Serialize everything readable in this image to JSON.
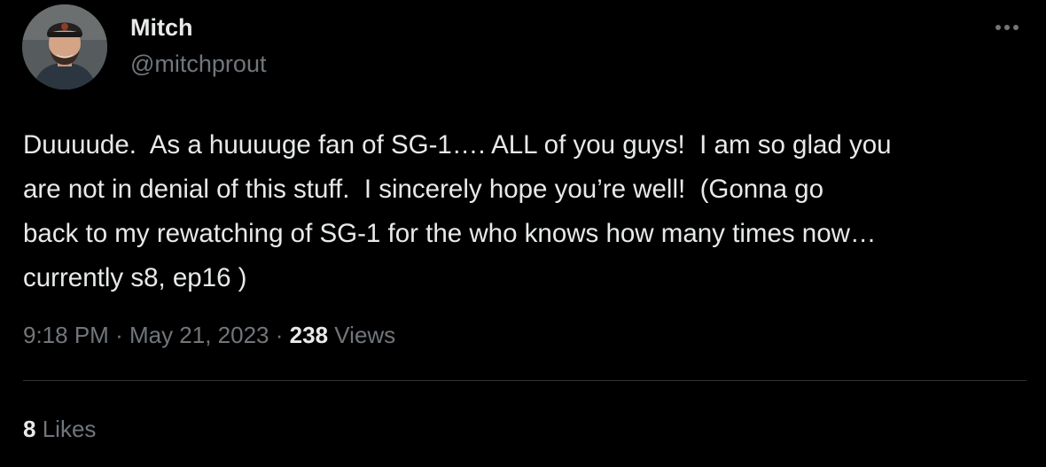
{
  "author": {
    "name": "Mitch",
    "handle": "@mitchprout"
  },
  "more_icon": "more-horizontal-icon",
  "tweet": {
    "text_lines": [
      "Duuuude.  As a huuuuge fan of SG-1…. ALL of you guys!  I am so glad you",
      "are not in denial of this stuff.  I sincerely hope you’re well!  (Gonna go",
      "back to my rewatching of SG-1 for the who knows how many times now…",
      "currently s8, ep16 )"
    ]
  },
  "meta": {
    "time": "9:18 PM",
    "separator": "·",
    "date": "May 21, 2023",
    "views_count": "238",
    "views_label": "Views"
  },
  "engagement": {
    "likes_count": "8",
    "likes_label": "Likes"
  },
  "colors": {
    "background": "#000000",
    "primary_text": "#e7e9ea",
    "secondary_text": "#71767b",
    "divider": "#2f3336"
  }
}
